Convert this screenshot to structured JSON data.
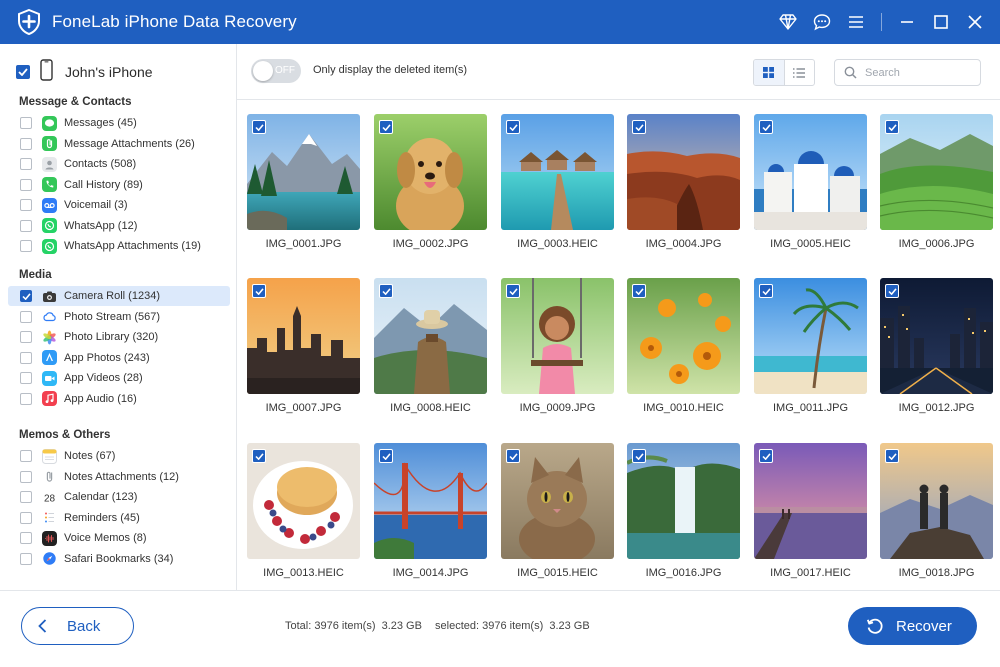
{
  "app": {
    "title": "FoneLab iPhone Data Recovery"
  },
  "sidebar": {
    "device": {
      "name": "John's iPhone",
      "checked": true
    },
    "sections": [
      {
        "title": "Message & Contacts",
        "items": [
          {
            "label": "Messages (45)",
            "icon": "messages-icon",
            "color": "#34c759"
          },
          {
            "label": "Message Attachments (26)",
            "icon": "attachment-icon",
            "color": "#34c759"
          },
          {
            "label": "Contacts (508)",
            "icon": "contacts-icon",
            "color": "#9aa0a6"
          },
          {
            "label": "Call History (89)",
            "icon": "phone-icon",
            "color": "#34c759"
          },
          {
            "label": "Voicemail (3)",
            "icon": "voicemail-icon",
            "color": "#2f7cf6"
          },
          {
            "label": "WhatsApp (12)",
            "icon": "whatsapp-icon",
            "color": "#25d366"
          },
          {
            "label": "WhatsApp Attachments (19)",
            "icon": "whatsapp-attachment-icon",
            "color": "#25d366"
          }
        ]
      },
      {
        "title": "Media",
        "items": [
          {
            "label": "Camera Roll (1234)",
            "icon": "camera-icon",
            "color": "#3a3a3a",
            "selected": true,
            "checked": true
          },
          {
            "label": "Photo Stream (567)",
            "icon": "cloud-icon",
            "color": "#2f7cf6"
          },
          {
            "label": "Photo Library (320)",
            "icon": "photos-icon",
            "color": "#f5a623"
          },
          {
            "label": "App Photos (243)",
            "icon": "app-photos-icon",
            "color": "#2f9bf6"
          },
          {
            "label": "App Videos (28)",
            "icon": "app-videos-icon",
            "color": "#2fb8f6"
          },
          {
            "label": "App Audio (16)",
            "icon": "music-icon",
            "color": "#f2404f"
          }
        ]
      },
      {
        "title": "Memos & Others",
        "items": [
          {
            "label": "Notes (67)",
            "icon": "notes-icon",
            "color": "#f7c948"
          },
          {
            "label": "Notes Attachments (12)",
            "icon": "notes-attachment-icon",
            "color": "#9aa0a6"
          },
          {
            "label": "Calendar (123)",
            "icon": "calendar-icon",
            "color": "#333333",
            "glyph": "28"
          },
          {
            "label": "Reminders (45)",
            "icon": "reminders-icon",
            "color": "#9aa0a6"
          },
          {
            "label": "Voice Memos (8)",
            "icon": "voice-memos-icon",
            "color": "#222222"
          },
          {
            "label": "Safari Bookmarks (34)",
            "icon": "safari-icon",
            "color": "#2f7cf6"
          }
        ]
      }
    ]
  },
  "toolbar": {
    "toggle_state": "OFF",
    "toggle_caption": "Only display the deleted item(s)",
    "view_mode": "grid",
    "search_placeholder": "Search"
  },
  "photos": [
    {
      "name": "IMG_0001.JPG",
      "scene": "mountain-lake"
    },
    {
      "name": "IMG_0002.JPG",
      "scene": "puppy"
    },
    {
      "name": "IMG_0003.HEIC",
      "scene": "tropical-pier"
    },
    {
      "name": "IMG_0004.JPG",
      "scene": "canyon"
    },
    {
      "name": "IMG_0005.HEIC",
      "scene": "santorini"
    },
    {
      "name": "IMG_0006.JPG",
      "scene": "green-hills"
    },
    {
      "name": "IMG_0007.JPG",
      "scene": "city-sunset"
    },
    {
      "name": "IMG_0008.HEIC",
      "scene": "hiker-mountains"
    },
    {
      "name": "IMG_0009.JPG",
      "scene": "child-swing"
    },
    {
      "name": "IMG_0010.HEIC",
      "scene": "orange-flowers"
    },
    {
      "name": "IMG_0011.JPG",
      "scene": "palm-beach"
    },
    {
      "name": "IMG_0012.JPG",
      "scene": "city-night"
    },
    {
      "name": "IMG_0013.HEIC",
      "scene": "pancakes"
    },
    {
      "name": "IMG_0014.JPG",
      "scene": "golden-gate"
    },
    {
      "name": "IMG_0015.HEIC",
      "scene": "cat"
    },
    {
      "name": "IMG_0016.JPG",
      "scene": "waterfall"
    },
    {
      "name": "IMG_0017.HEIC",
      "scene": "pier-sunset"
    },
    {
      "name": "IMG_0018.JPG",
      "scene": "couple-sunset"
    }
  ],
  "footer": {
    "back_label": "Back",
    "total_text": "Total: 3976 item(s)  3.23 GB",
    "selected_text": "selected: 3976 item(s)  3.23 GB",
    "recover_label": "Recover"
  },
  "colors": {
    "accent": "#1f5fc0",
    "selected_row": "#dce9fb"
  }
}
